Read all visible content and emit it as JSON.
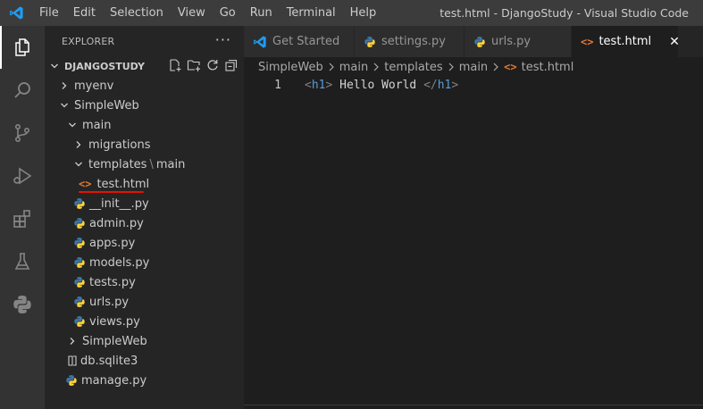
{
  "titlebar": {
    "menu": [
      "File",
      "Edit",
      "Selection",
      "View",
      "Go",
      "Run",
      "Terminal",
      "Help"
    ],
    "window_title": "test.html - DjangoStudy - Visual Studio Code"
  },
  "activitybar": {
    "items": [
      "explorer-icon",
      "search-icon",
      "source-control-icon",
      "run-debug-icon",
      "extensions-icon",
      "testing-icon",
      "python-icon"
    ]
  },
  "sidebar": {
    "header": "EXPLORER",
    "more": "···",
    "section_title": "DJANGOSTUDY",
    "tree": {
      "myenv": "myenv",
      "simpleweb": "SimpleWeb",
      "main": "main",
      "migrations": "migrations",
      "templates": "templates",
      "templates_main": "main",
      "test_html": "test.html",
      "init_py": "__init__.py",
      "admin_py": "admin.py",
      "apps_py": "apps.py",
      "models_py": "models.py",
      "tests_py": "tests.py",
      "urls_py": "urls.py",
      "views_py": "views.py",
      "simpleweb_inner": "SimpleWeb",
      "db": "db.sqlite3",
      "manage_py": "manage.py"
    }
  },
  "tabs": [
    {
      "label": "Get Started"
    },
    {
      "label": "settings.py"
    },
    {
      "label": "urls.py"
    },
    {
      "label": "test.html",
      "close": "✕"
    }
  ],
  "breadcrumb": [
    "SimpleWeb",
    "main",
    "templates",
    "main",
    "test.html"
  ],
  "editor": {
    "line_number": "1",
    "open_tag_lt": "<",
    "open_tag_name": "h1",
    "open_tag_gt": ">",
    "content": " Hello World ",
    "close_tag_lt": "</",
    "close_tag_name": "h1",
    "close_tag_gt": ">"
  },
  "colors": {
    "accent_blue": "#007acc",
    "html_icon": "#e37933",
    "python_blue": "#3c78aa",
    "python_yellow": "#ffd43b",
    "tag_blue": "#569cd6",
    "underline_red": "#e51400"
  }
}
